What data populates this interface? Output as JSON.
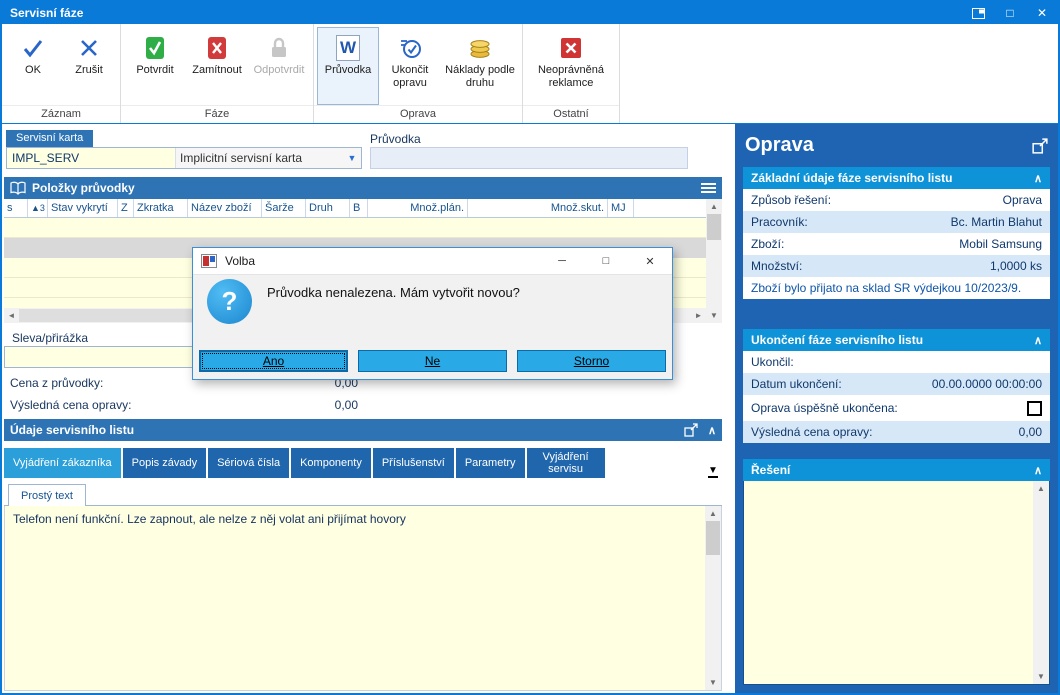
{
  "window": {
    "title": "Servisní fáze"
  },
  "icons": {
    "maximize": "□",
    "close": "✕",
    "minimize": "─",
    "combo_pick": "▼",
    "sort_badge": "▲3",
    "left": "◄",
    "right": "►",
    "up": "▲",
    "down": "▼",
    "chevron_up": "∧",
    "more_tabs": "▼",
    "word": "W",
    "question": "?"
  },
  "toolbar": {
    "buttons": {
      "ok": "OK",
      "zrusit": "Zrušit",
      "potvrdit": "Potvrdit",
      "zamitnout": "Zamítnout",
      "odpotvrdit": "Odpotvrdit",
      "pruvodka": "Průvodka",
      "ukoncit": "Ukončit opravu",
      "naklady": "Náklady podle druhu",
      "neopravnena": "Neoprávněná reklamce"
    },
    "groups": {
      "zaznam": "Záznam",
      "faze": "Fáze",
      "oprava": "Oprava",
      "ostatni": "Ostatní"
    }
  },
  "form": {
    "servisni_karta_label": "Servisní karta",
    "servisni_karta_code": "IMPL_SERV",
    "servisni_karta_name": "Implicitní servisní karta",
    "pruvodka_label": "Průvodka",
    "pruvodka_value": "",
    "sleva_label": "Sleva/přirážka",
    "sleva_value": ""
  },
  "polozky": {
    "title": "Položky průvodky",
    "columns": [
      "s",
      "▲3",
      "Stav vykrytí",
      "Z",
      "Zkratka",
      "Název zboží",
      "Šarže",
      "Druh",
      "B",
      "Množ.plán.",
      "Množ.skut.",
      "MJ"
    ]
  },
  "ceny": {
    "cena_z_pruvodky_label": "Cena z průvodky:",
    "cena_z_pruvodky_value": "0,00",
    "vysledna_label": "Výsledná cena opravy:",
    "vysledna_value": "0,00"
  },
  "udaje": {
    "title": "Údaje servisního listu",
    "tabs": [
      "Vyjádření zákazníka",
      "Popis závady",
      "Sériová čísla",
      "Komponenty",
      "Příslušenství",
      "Parametry",
      "Vyjádření servisu"
    ],
    "subtab": "Prostý text",
    "text": "Telefon není funkční. Lze zapnout, ale nelze z něj volat ani přijímat hovory"
  },
  "sidebar": {
    "title": "Oprava",
    "zakladni": {
      "title": "Základní údaje fáze servisního listu",
      "fields": [
        {
          "label": "Způsob řešení:",
          "value": "Oprava"
        },
        {
          "label": "Pracovník:",
          "value": "Bc. Martin Blahut"
        },
        {
          "label": "Zboží:",
          "value": "Mobil Samsung"
        },
        {
          "label": "Množství:",
          "value": "1,0000 ks"
        }
      ],
      "note": "Zboží bylo přijato na sklad SR výdejkou 10/2023/9."
    },
    "ukonceni": {
      "title": "Ukončení fáze servisního listu",
      "fields": [
        {
          "label": "Ukončil:",
          "value": ""
        },
        {
          "label": "Datum ukončení:",
          "value": "00.00.0000 00:00:00"
        },
        {
          "label": "Oprava úspěšně ukončena:",
          "value": ""
        },
        {
          "label": "Výsledná cena opravy:",
          "value": "0,00"
        }
      ]
    },
    "reseni": {
      "title": "Řešení",
      "text": ""
    }
  },
  "dialog": {
    "title": "Volba",
    "message": "Průvodka nenalezena. Mám vytvořit novou?",
    "buttons": [
      "Ano",
      "Ne",
      "Storno"
    ]
  }
}
